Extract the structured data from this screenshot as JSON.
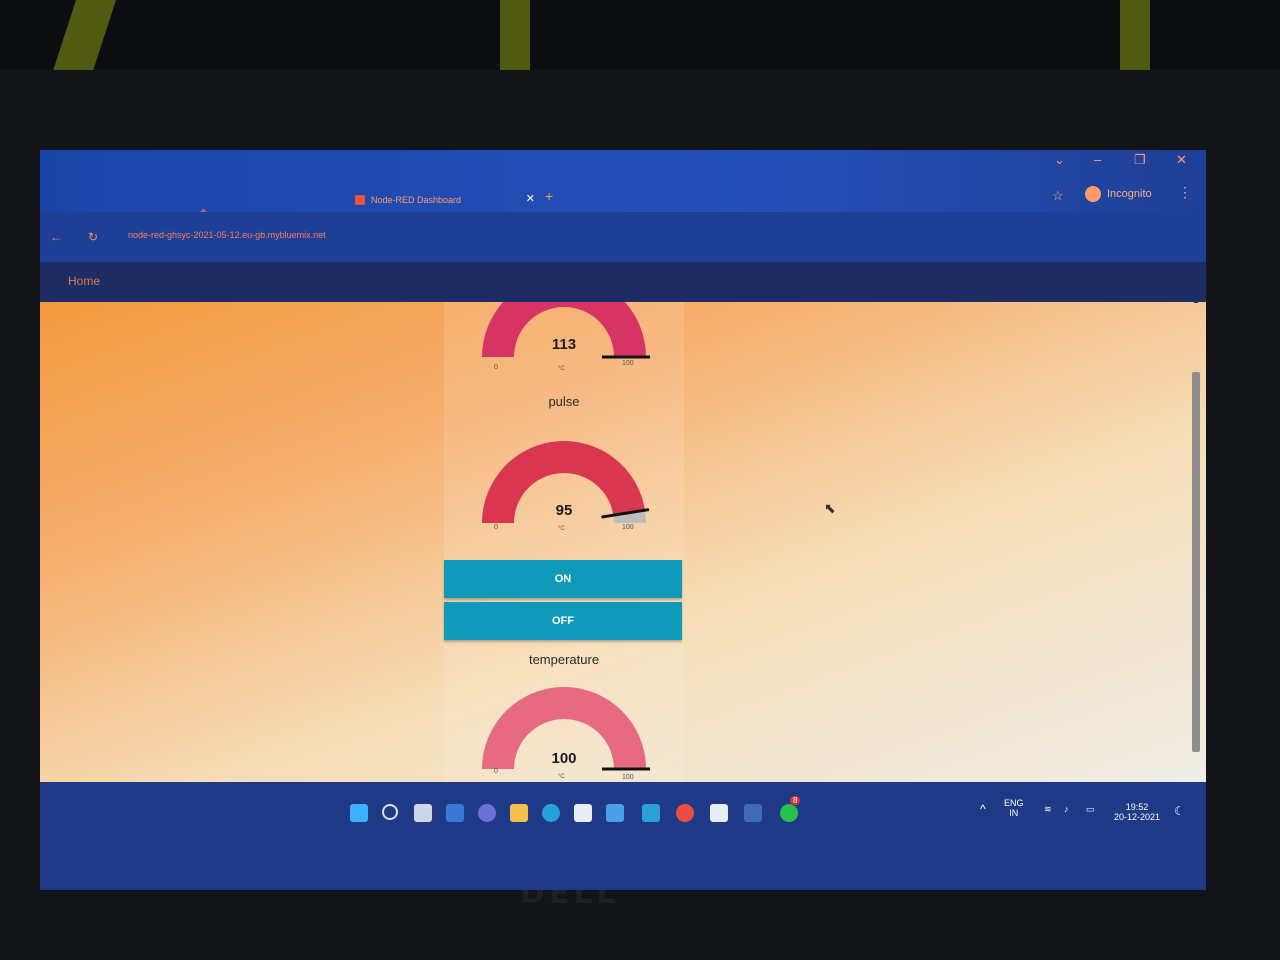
{
  "browser": {
    "tab_title": "Node-RED Dashboard",
    "tab_close": "✕",
    "new_tab": "+",
    "incognito_label": "Incognito",
    "url": "node-red-ghsyc-2021-05-12.eu-gb.mybluemix.net"
  },
  "dashboard": {
    "title": "Home",
    "widgets": [
      {
        "label": "",
        "value": "113",
        "unit": "°C",
        "min": "0",
        "max": "100",
        "level": 1.0,
        "color": "#d63563"
      },
      {
        "label": "pulse",
        "value": "95",
        "unit": "°C",
        "min": "0",
        "max": "100",
        "level": 0.95,
        "color": "#d93650"
      },
      {
        "label": "temperature",
        "value": "100",
        "unit": "°C",
        "min": "0",
        "max": "100",
        "level": 1.0,
        "color": "#e86a80"
      }
    ],
    "buttons": {
      "on": "ON",
      "off": "OFF"
    }
  },
  "taskbar": {
    "lang_1": "ENG",
    "lang_2": "IN",
    "time": "19:52",
    "date": "20-12-2021",
    "whatsapp_badge": "8"
  },
  "device": {
    "brand": "DELL"
  }
}
